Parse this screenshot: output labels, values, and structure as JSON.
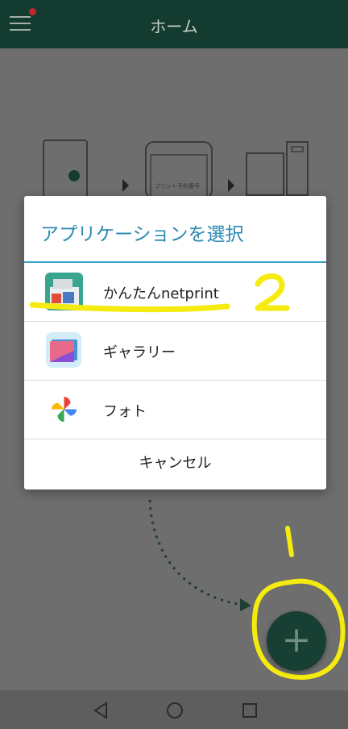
{
  "header": {
    "title": "ホーム"
  },
  "dialog": {
    "title": "アプリケーションを選択",
    "options": [
      {
        "label": "かんたんnetprint",
        "icon": "netprint-app-icon"
      },
      {
        "label": "ギャラリー",
        "icon": "gallery-app-icon"
      },
      {
        "label": "フォト",
        "icon": "google-photos-icon"
      }
    ],
    "cancel_label": "キャンセル"
  },
  "illustration": {
    "phone_text_line1": "プリント予約番号"
  },
  "annotations": {
    "step_1": "1",
    "step_2": "2"
  },
  "fab": {
    "label": "+"
  },
  "colors": {
    "appbar": "#143b30",
    "dialog_title": "#2d8ab3",
    "annotation": "#f5eb0f",
    "fab": "#173f33"
  }
}
